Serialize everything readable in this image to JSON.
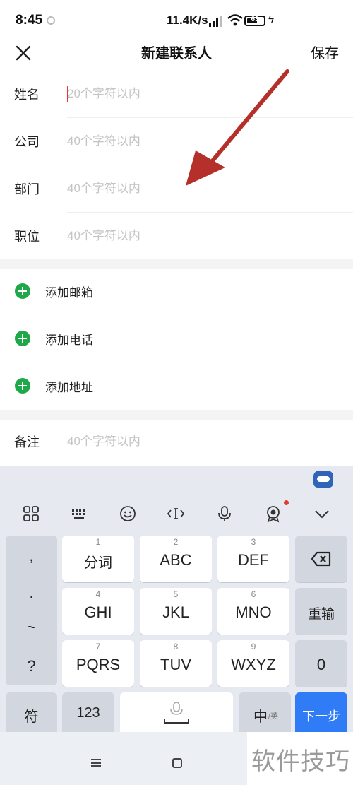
{
  "status_bar": {
    "time": "8:45",
    "net_speed": "11.4K/s",
    "battery_level": "63"
  },
  "header": {
    "title": "新建联系人",
    "save_label": "保存"
  },
  "form": {
    "name": {
      "label": "姓名",
      "placeholder": "20个字符以内"
    },
    "company": {
      "label": "公司",
      "placeholder": "40个字符以内"
    },
    "department": {
      "label": "部门",
      "placeholder": "40个字符以内"
    },
    "position": {
      "label": "职位",
      "placeholder": "40个字符以内"
    }
  },
  "add_actions": {
    "email": "添加邮箱",
    "phone": "添加电话",
    "address": "添加地址"
  },
  "notes": {
    "label": "备注",
    "placeholder": "40个字符以内"
  },
  "keyboard": {
    "punctuation": [
      ",",
      ".",
      "~",
      "?"
    ],
    "keys": [
      {
        "num": "1",
        "label": "分词"
      },
      {
        "num": "2",
        "label": "ABC"
      },
      {
        "num": "3",
        "label": "DEF"
      },
      {
        "num": "4",
        "label": "GHI"
      },
      {
        "num": "5",
        "label": "JKL"
      },
      {
        "num": "6",
        "label": "MNO"
      },
      {
        "num": "7",
        "label": "PQRS"
      },
      {
        "num": "8",
        "label": "TUV"
      },
      {
        "num": "9",
        "label": "WXYZ"
      }
    ],
    "reenter_label": "重输",
    "zero_label": "0",
    "symbol_label": "符",
    "numeric_label": "123",
    "lang_label": "中",
    "lang_sub": "/英",
    "next_label": "下一步"
  },
  "watermark": "软件技巧",
  "colors": {
    "accent_green": "#1ea84a",
    "annotation_red": "#b5302a",
    "key_blue": "#2f7cf6"
  },
  "icons": [
    "close-icon",
    "plus-circle-icon",
    "apps-grid-icon",
    "keyboard-icon",
    "emoji-icon",
    "cursor-icon",
    "microphone-icon",
    "badge-icon",
    "chevron-down-icon",
    "backspace-icon"
  ]
}
